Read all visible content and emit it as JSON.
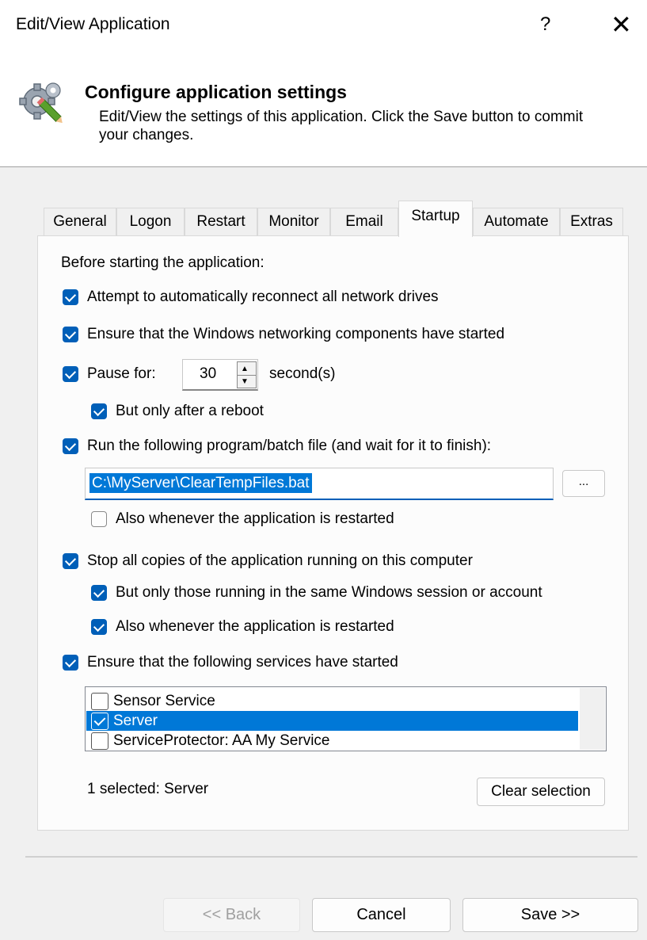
{
  "window": {
    "title": "Edit/View Application",
    "help": "?",
    "close": "✕"
  },
  "header": {
    "title": "Configure application settings",
    "desc_line1": "Edit/View the settings of this application. Click the Save button to commit",
    "desc_line2": "your changes."
  },
  "tabs": [
    "General",
    "Logon",
    "Restart",
    "Monitor",
    "Email",
    "Startup",
    "Automate",
    "Extras"
  ],
  "active_tab": "Startup",
  "startup": {
    "intro": "Before starting the application:",
    "reconnect_drives": {
      "label": "Attempt to automatically reconnect all network drives",
      "checked": true
    },
    "ensure_networking": {
      "label": "Ensure that the Windows networking components have started",
      "checked": true
    },
    "pause": {
      "label": "Pause for:",
      "checked": true,
      "value": "30",
      "unit": "second(s)"
    },
    "pause_only_reboot": {
      "label": "But only after a reboot",
      "checked": true
    },
    "run_program": {
      "label": "Run the following program/batch file (and wait for it to finish):",
      "checked": true,
      "path": "C:\\MyServer\\ClearTempFiles.bat",
      "browse": "..."
    },
    "run_also_restart": {
      "label": "Also whenever the application is restarted",
      "checked": false
    },
    "stop_copies": {
      "label": "Stop all copies of the application running on this computer",
      "checked": true
    },
    "stop_same_session": {
      "label": "But only those running in the same Windows session or account",
      "checked": true
    },
    "stop_also_restart": {
      "label": "Also whenever the application is restarted",
      "checked": true
    },
    "ensure_services": {
      "label": "Ensure that the following services have started",
      "checked": true
    },
    "services": [
      {
        "name": "Sensor Service",
        "checked": false,
        "selected": false
      },
      {
        "name": "Server",
        "checked": true,
        "selected": true
      },
      {
        "name": "ServiceProtector: AA My Service",
        "checked": false,
        "selected": false
      }
    ],
    "selected_summary": "1 selected: Server",
    "clear_selection": "Clear selection"
  },
  "footer": {
    "back": "<< Back",
    "cancel": "Cancel",
    "save": "Save >>"
  },
  "colors": {
    "accent": "#005fb8",
    "selection": "#0078d7"
  },
  "icons": {
    "header": "gear-pencil-icon"
  }
}
